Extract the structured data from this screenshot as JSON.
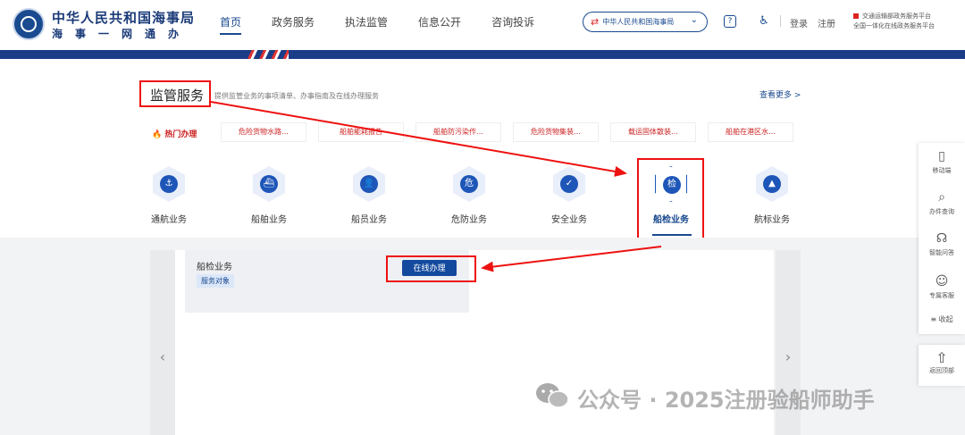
{
  "header": {
    "logo_title": "中华人民共和国海事局",
    "logo_subtitle": "海事一网通办",
    "nav": [
      "首页",
      "政务服务",
      "执法监管",
      "信息公开",
      "咨询投诉"
    ],
    "org_select": "中华人民共和国海事局",
    "login": "登录",
    "register": "注册",
    "platform_line1": "交通运输部政务服务平台",
    "platform_line2": "全国一体化在线政务服务平台"
  },
  "section": {
    "title": "监管服务",
    "desc": "提供监管业务的事项清单、办事指南及在线办理服务",
    "more": "查看更多 >",
    "hot_label": "热门办理",
    "hot_items": [
      "危险货物水路…",
      "船舶能耗报告",
      "船舶防污染作…",
      "危险货物集装…",
      "载运固体散装…",
      "船舶在港区水…"
    ]
  },
  "categories": [
    {
      "label": "通航业务",
      "glyph": "⚓"
    },
    {
      "label": "船舶业务",
      "glyph": "⛴"
    },
    {
      "label": "船员业务",
      "glyph": "👤"
    },
    {
      "label": "危防业务",
      "glyph": "危"
    },
    {
      "label": "安全业务",
      "glyph": "✓"
    },
    {
      "label": "船检业务",
      "glyph": "检"
    },
    {
      "label": "航标业务",
      "glyph": "▲"
    }
  ],
  "panel": {
    "card_title": "船检业务",
    "card_tag": "服务对象",
    "online_button": "在线办理",
    "prev": "‹",
    "next": "›"
  },
  "float_menu": [
    "移动端",
    "办件查询",
    "智能问答",
    "专属客服",
    "收起"
  ],
  "back_top": "返回顶部",
  "watermark": "公众号 · 2025注册验船师助手",
  "colors": {
    "brand": "#1a4a8f",
    "annotation": "#e11111",
    "hot": "#cc2222"
  }
}
